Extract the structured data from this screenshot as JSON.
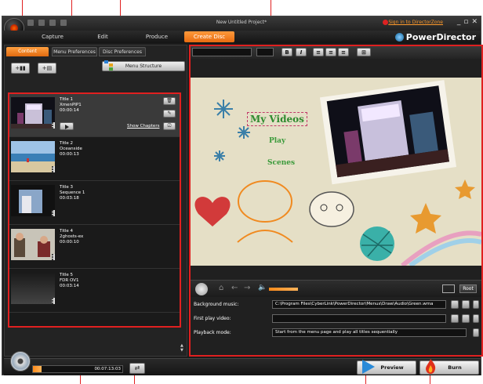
{
  "window": {
    "title": "New Untitled Project*",
    "sign_in": "Sign in to DirectorZone",
    "brand": "PowerDirector",
    "controls": [
      "_",
      "▫",
      "✕"
    ]
  },
  "main_tabs": [
    {
      "label": "Capture",
      "active": false
    },
    {
      "label": "Edit",
      "active": false
    },
    {
      "label": "Produce",
      "active": false
    },
    {
      "label": "Create Disc",
      "active": true
    }
  ],
  "sub_tabs": [
    {
      "label": "Content",
      "active": true
    },
    {
      "label": "Menu Preferences",
      "active": false
    },
    {
      "label": "Disc Preferences",
      "active": false
    }
  ],
  "toolbar": {
    "menu_structure_label": "Menu Structure"
  },
  "titles": [
    {
      "name": "Title 1",
      "file": "XmenPIP1",
      "duration": "00:00:14",
      "show_chapters": "Show Chapters"
    },
    {
      "name": "Title 2",
      "file": "Oceanside",
      "duration": "00:00:13"
    },
    {
      "name": "Title 3",
      "file": "Sequence 1",
      "duration": "00:03:18"
    },
    {
      "name": "Title 4",
      "file": "2ghosts-ex",
      "duration": "00:00:10"
    },
    {
      "name": "Title 5",
      "file": "FDR OV1",
      "duration": "00:03:14"
    }
  ],
  "menu_preview": {
    "items": [
      "My Videos",
      "Play",
      "Scenes"
    ]
  },
  "nav": {
    "root_label": "Root",
    "volume_fraction": 0.75
  },
  "settings": {
    "background_music": {
      "label": "Background music:",
      "value": "C:\\Program Files\\CyberLink\\PowerDirector\\Menus\\Draw\\Audio\\Green.wma"
    },
    "first_play_video": {
      "label": "First play video:",
      "value": ""
    },
    "playback_mode": {
      "label": "Playback mode:",
      "value": "Start from the menu page and play all titles sequentially"
    }
  },
  "bottom": {
    "capacity_used": "00:07:13:03",
    "capacity_fraction": 0.1,
    "preview_label": "Preview",
    "burn_label": "Burn"
  },
  "colors": {
    "accent": "#ff8a1a",
    "annotation": "#e02020",
    "brand_blue": "#1a78c8"
  }
}
